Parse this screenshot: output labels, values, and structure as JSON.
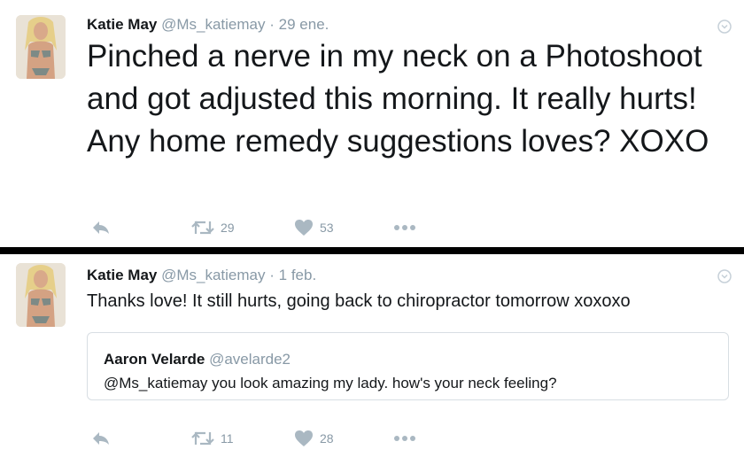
{
  "tweets": [
    {
      "author_name": "Katie May",
      "author_handle": "@Ms_katiemay",
      "separator": "·",
      "date": "29 ene.",
      "text": "Pinched a nerve in my neck on a Photoshoot and got adjusted this morning. It really hurts! Any home remedy suggestions loves? XOXO",
      "retweets": "29",
      "likes": "53"
    },
    {
      "author_name": "Katie May",
      "author_handle": "@Ms_katiemay",
      "separator": "·",
      "date": "1 feb.",
      "text": "Thanks love! It still hurts, going back to chiropractor tomorrow xoxoxo",
      "quoted": {
        "author_name": "Aaron Velarde",
        "author_handle": "@avelarde2",
        "text": "@Ms_katiemay you look amazing my lady. how's your neck feeling?"
      },
      "retweets": "11",
      "likes": "28"
    }
  ],
  "icons": {
    "reply": "reply-icon",
    "retweet": "retweet-icon",
    "like": "heart-icon",
    "more": "more-dots-icon",
    "caret": "chevron-down-icon"
  },
  "colors": {
    "text": "#14171a",
    "muted": "#8899a6",
    "icon": "#aab8c2",
    "divider": "#000000",
    "border": "#d8dee3"
  }
}
